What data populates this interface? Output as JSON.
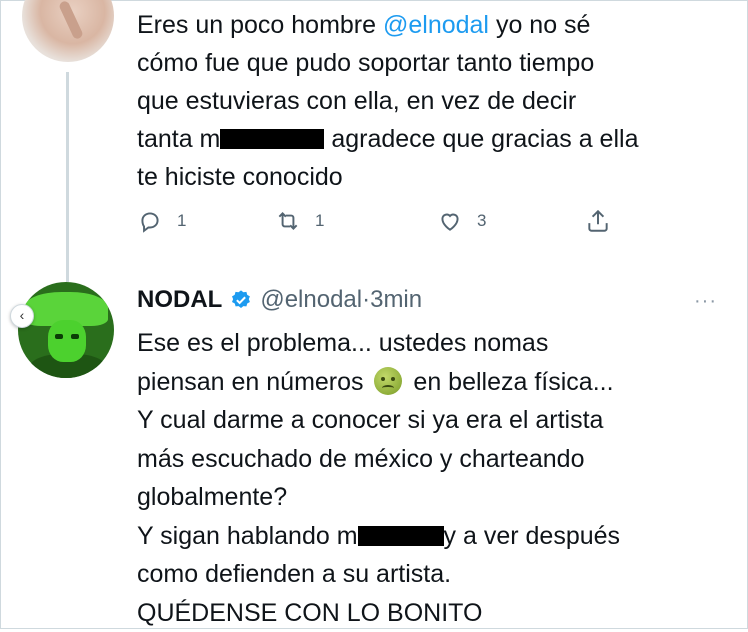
{
  "reply_tweet": {
    "line1_a": "Eres un poco hombre ",
    "mention": "@elnodal",
    "line1_b": " yo no sé",
    "line2": "cómo fue que pudo soportar tanto tiempo",
    "line3": "que estuvieras con ella, en vez de decir",
    "line4_a": "tanta m",
    "line4_b": " agradece que gracias a ella",
    "line5": "te hiciste conocido",
    "actions": {
      "replies": "1",
      "retweets": "1",
      "likes": "3"
    }
  },
  "nodal_tweet": {
    "display_name": "NODAL",
    "handle": "@elnodal",
    "separator": " · ",
    "time": "3min",
    "more": "···",
    "lines": {
      "l1": "Ese es el problema... ustedes nomas",
      "l2_a": "piensan en números ",
      "l2_b": " en belleza física...",
      "l3": "Y cual darme a conocer si ya era el artista",
      "l4": "más escuchado de méxico y charteando",
      "l5": "globalmente?",
      "l6_a": "Y sigan hablando m",
      "l6_b": "y a ver después",
      "l7": "como defienden a su artista.",
      "l8": "QUÉDENSE CON LO BONITO"
    },
    "emoji": "nauseated-face-icon"
  },
  "colors": {
    "mention": "#1d9bf0",
    "verified": "#1d9bf0",
    "secondary_text": "#536471",
    "text": "#0f1419"
  }
}
